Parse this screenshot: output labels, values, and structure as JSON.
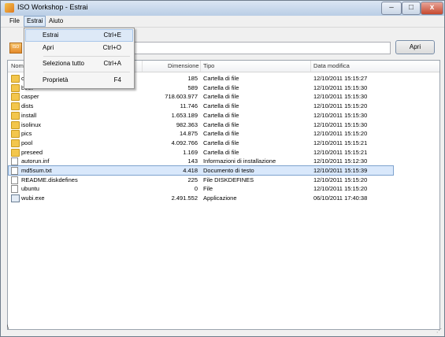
{
  "window": {
    "title": "ISO Workshop - Estrai"
  },
  "titlebar": {
    "minimize": "–",
    "maximize": "□",
    "close": "x"
  },
  "menubar": {
    "items": [
      "File",
      "Estrai",
      "Aiuto"
    ]
  },
  "toolbar": {
    "icon_label": "ISO",
    "open_button": "Apri",
    "path_value": ""
  },
  "columns": [
    "Nome",
    "Dimensione",
    "Tipo",
    "Data modifica"
  ],
  "files": [
    {
      "name": "casper",
      "size": "185",
      "type": "Cartella di file",
      "date": "12/10/2011 15:15:27",
      "icon": "folder"
    },
    {
      "name": "boot",
      "size": "589",
      "type": "Cartella di file",
      "date": "12/10/2011 15:15:30",
      "icon": "folder"
    },
    {
      "name": "casper",
      "size": "718.603.977",
      "type": "Cartella di file",
      "date": "12/10/2011 15:15:30",
      "icon": "folder"
    },
    {
      "name": "dists",
      "size": "11.746",
      "type": "Cartella di file",
      "date": "12/10/2011 15:15:20",
      "icon": "folder"
    },
    {
      "name": "install",
      "size": "1.653.189",
      "type": "Cartella di file",
      "date": "12/10/2011 15:15:30",
      "icon": "folder"
    },
    {
      "name": "isolinux",
      "size": "982.363",
      "type": "Cartella di file",
      "date": "12/10/2011 15:15:30",
      "icon": "folder"
    },
    {
      "name": "pics",
      "size": "14.875",
      "type": "Cartella di file",
      "date": "12/10/2011 15:15:20",
      "icon": "folder"
    },
    {
      "name": "pool",
      "size": "4.092.766",
      "type": "Cartella di file",
      "date": "12/10/2011 15:15:21",
      "icon": "folder"
    },
    {
      "name": "preseed",
      "size": "1.169",
      "type": "Cartella di file",
      "date": "12/10/2011 15:15:21",
      "icon": "folder"
    },
    {
      "name": "autorun.inf",
      "size": "143",
      "type": "Informazioni di installazione",
      "date": "12/10/2011 15:12:30",
      "icon": "file"
    },
    {
      "name": "md5sum.txt",
      "size": "4.418",
      "type": "Documento di testo",
      "date": "12/10/2011 15:15:39",
      "icon": "file",
      "selected": true
    },
    {
      "name": "README.diskdefines",
      "size": "225",
      "type": "File DISKDEFINES",
      "date": "12/10/2011 15:15:20",
      "icon": "file"
    },
    {
      "name": "ubuntu",
      "size": "0",
      "type": "File",
      "date": "12/10/2011 15:15:20",
      "icon": "file"
    },
    {
      "name": "wubi.exe",
      "size": "2.491.552",
      "type": "Applicazione",
      "date": "06/10/2011 17:40:38",
      "icon": "exe"
    }
  ],
  "dropdown": {
    "items": [
      {
        "label": "Estrai",
        "shortcut": "Ctrl+E",
        "highlighted": true
      },
      {
        "label": "Apri",
        "shortcut": "Ctrl+O"
      },
      {
        "label": "Seleziona tutto",
        "shortcut": "Ctrl+A"
      },
      {
        "label": "Proprietà",
        "shortcut": "F4"
      }
    ]
  },
  "statusbar": {
    "text": "\\"
  }
}
